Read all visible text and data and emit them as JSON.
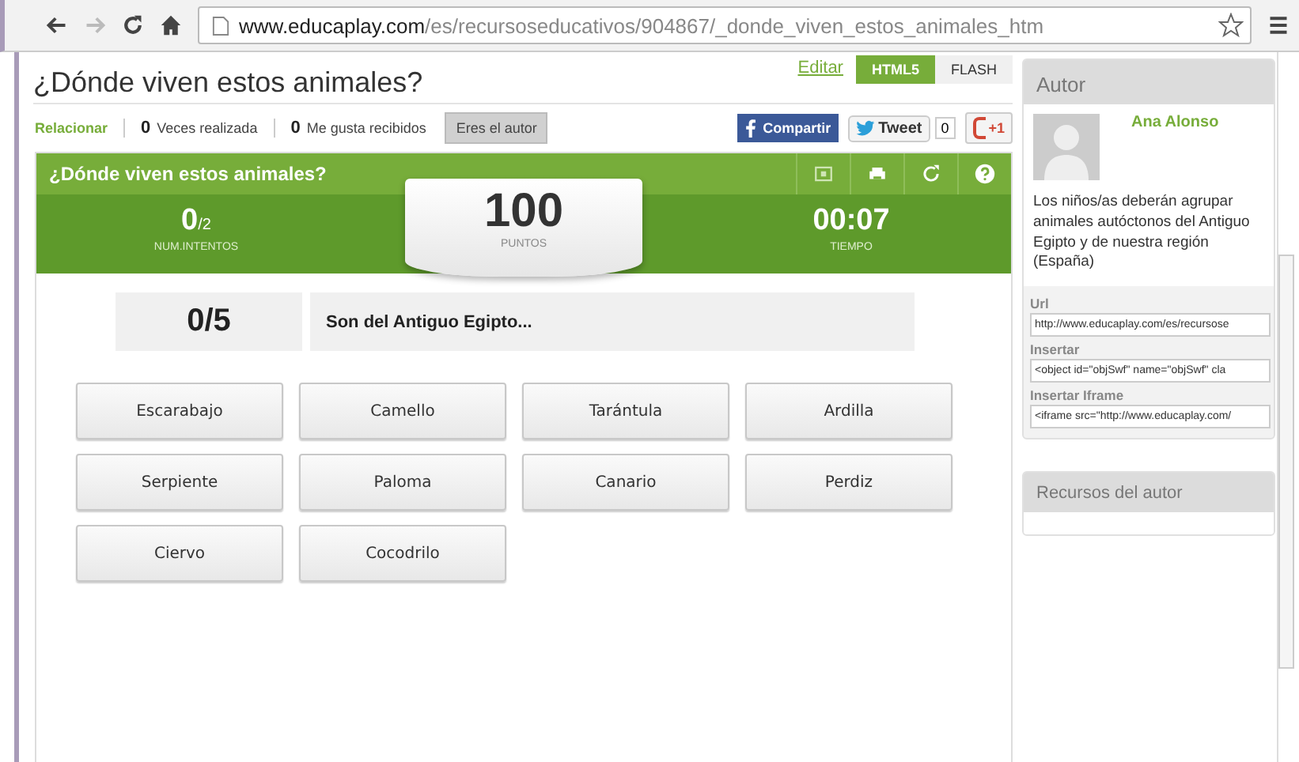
{
  "browser": {
    "url_domain": "www.educaplay.com",
    "url_path": "/es/recursoseducativos/904867/_donde_viven_estos_animales_htm"
  },
  "page": {
    "title": "¿Dónde viven estos animales?",
    "edit_link": "Editar",
    "formats": [
      {
        "label": "HTML5",
        "selected": true
      },
      {
        "label": "FLASH",
        "selected": false
      }
    ],
    "relate_link": "Relacionar",
    "counts": [
      {
        "value": "0",
        "label": "Veces realizada"
      },
      {
        "value": "0",
        "label": "Me gusta recibidos"
      }
    ],
    "author_button": "Eres el autor",
    "share": {
      "facebook": "Compartir",
      "tweet": "Tweet",
      "tweet_count": "0",
      "gplus": "+1"
    }
  },
  "game": {
    "title": "¿Dónde viven estos animales?",
    "attempts": {
      "value": "0",
      "total": "/2",
      "label": "NUM.INTENTOS"
    },
    "points": {
      "value": "100",
      "label": "PUNTOS"
    },
    "time": {
      "value": "00:07",
      "label": "TIEMPO"
    },
    "score": "0/5",
    "category": "Son del Antiguo Egipto...",
    "options": [
      "Escarabajo",
      "Camello",
      "Tarántula",
      "Ardilla",
      "Serpiente",
      "Paloma",
      "Canario",
      "Perdiz",
      "Ciervo",
      "Cocodrilo"
    ]
  },
  "sidebar": {
    "author_heading": "Autor",
    "author_name": "Ana Alonso",
    "description": "Los niños/as deberán agrupar animales autóctonos del Antiguo Egipto y de nuestra región (España)",
    "fields": [
      {
        "label": "Url",
        "value": "http://www.educaplay.com/es/recursose"
      },
      {
        "label": "Insertar",
        "value": "<object id=\"objSwf\" name=\"objSwf\" cla"
      },
      {
        "label": "Insertar Iframe",
        "value": "<iframe src=\"http://www.educaplay.com/"
      }
    ],
    "resources_heading": "Recursos del autor"
  }
}
